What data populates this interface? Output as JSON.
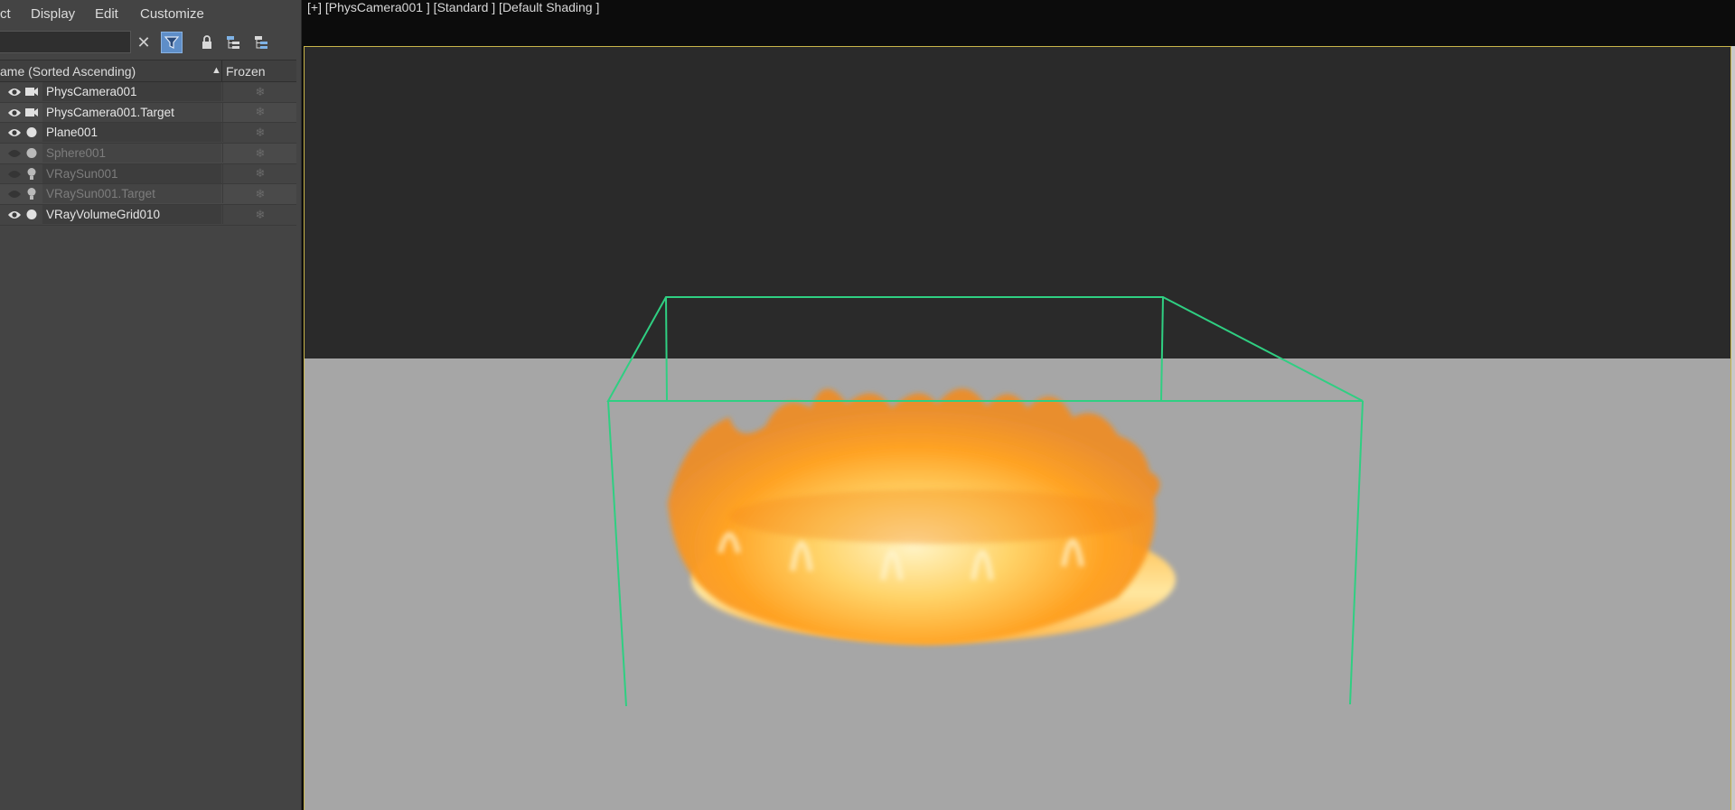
{
  "menu": {
    "items": [
      "ct",
      "Display",
      "Edit",
      "Customize"
    ]
  },
  "toolbar": {
    "search_value": "",
    "icons": [
      "clear-search-icon",
      "filter-icon",
      "lock-icon",
      "hierarchy-icon",
      "hierarchy-alt-icon"
    ]
  },
  "columns": {
    "name": "ame (Sorted Ascending)",
    "sort_indicator": "▲",
    "frozen": "Frozen"
  },
  "objects": [
    {
      "name": "PhysCamera001",
      "type": "camera",
      "visible": true
    },
    {
      "name": "PhysCamera001.Target",
      "type": "camera",
      "visible": true
    },
    {
      "name": "Plane001",
      "type": "geometry",
      "visible": true
    },
    {
      "name": "Sphere001",
      "type": "geometry",
      "visible": false
    },
    {
      "name": "VRaySun001",
      "type": "light",
      "visible": false
    },
    {
      "name": "VRaySun001.Target",
      "type": "light",
      "visible": false
    },
    {
      "name": "VRayVolumeGrid010",
      "type": "geometry",
      "visible": true
    }
  ],
  "viewport": {
    "label": "[+] [PhysCamera001 ] [Standard ] [Default Shading ]"
  },
  "colors": {
    "panel_bg": "#444444",
    "viewport_border": "#c9b54a",
    "bounding_box": "#2fcf82",
    "sky": "#2a2a2a",
    "ground": "#a6a6a6",
    "fire": "#ffa51f"
  }
}
